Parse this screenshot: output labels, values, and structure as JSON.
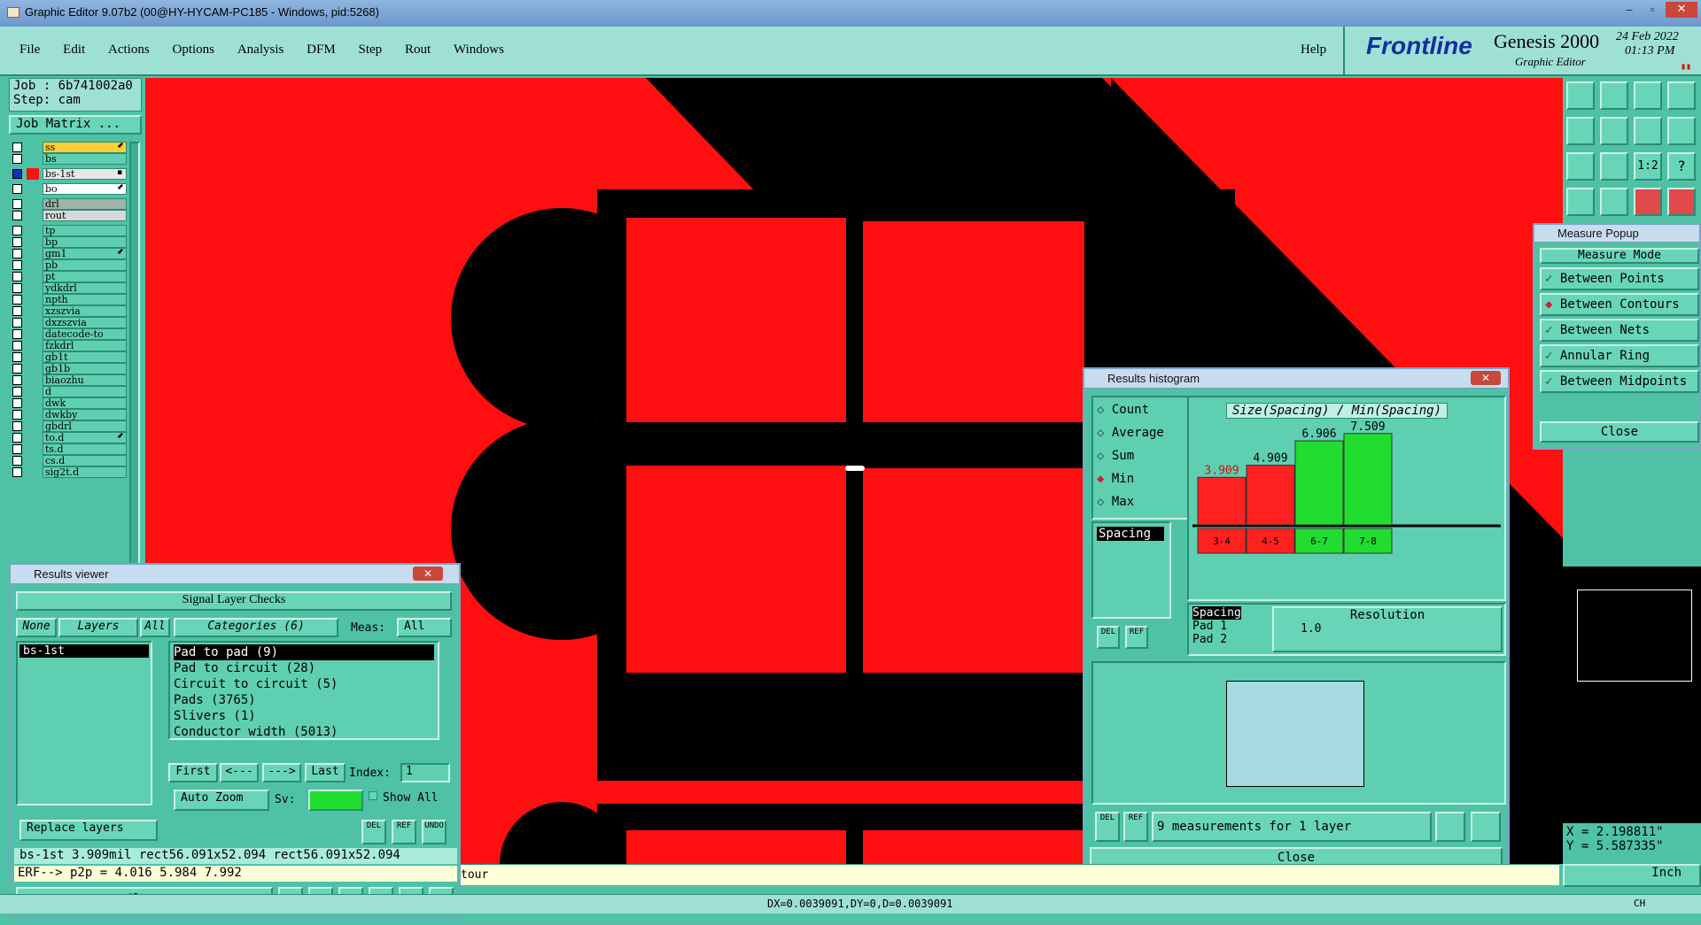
{
  "window_title": "Graphic Editor 9.07b2 (00@HY-HYCAM-PC185 - Windows, pid:5268)",
  "menu": [
    "File",
    "Edit",
    "Actions",
    "Options",
    "Analysis",
    "DFM",
    "Step",
    "Rout",
    "Windows"
  ],
  "help": "Help",
  "brand": {
    "logo": "Frontline",
    "product": "Genesis 2000",
    "sub": "Graphic Editor",
    "date": "24 Feb 2022",
    "time": "01:13 PM"
  },
  "job": {
    "job": "Job : 6b741002a0",
    "step": "Step: cam",
    "matrix": "Job Matrix ..."
  },
  "layers": [
    {
      "name": "ss",
      "color": "#ffcf3a",
      "mark": "⬋"
    },
    {
      "name": "bs",
      "color": "#5fcfb1",
      "mark": ""
    },
    {
      "name": "bs-1st",
      "color": "#e8e8e8",
      "mark": "▪",
      "active": true
    },
    {
      "name": "bo",
      "color": "#ffffff",
      "mark": "⬋"
    },
    {
      "name": "drl",
      "color": "#9fb3a8",
      "mark": ""
    },
    {
      "name": "rout",
      "color": "#d8d8d8",
      "mark": ""
    },
    {
      "name": "tp",
      "color": "#5fcfb1",
      "mark": ""
    },
    {
      "name": "bp",
      "color": "#5fcfb1",
      "mark": ""
    },
    {
      "name": "gm1",
      "color": "#5fcfb1",
      "mark": "⬋"
    },
    {
      "name": "pb",
      "color": "#5fcfb1",
      "mark": ""
    },
    {
      "name": "pt",
      "color": "#5fcfb1",
      "mark": ""
    },
    {
      "name": "ydkdrl",
      "color": "#5fcfb1",
      "mark": ""
    },
    {
      "name": "npth",
      "color": "#5fcfb1",
      "mark": ""
    },
    {
      "name": "xzszvia",
      "color": "#5fcfb1",
      "mark": ""
    },
    {
      "name": "dxzszvia",
      "color": "#5fcfb1",
      "mark": ""
    },
    {
      "name": "datecode-to",
      "color": "#5fcfb1",
      "mark": ""
    },
    {
      "name": "fzkdrl",
      "color": "#5fcfb1",
      "mark": ""
    },
    {
      "name": "gb1t",
      "color": "#5fcfb1",
      "mark": ""
    },
    {
      "name": "gb1b",
      "color": "#5fcfb1",
      "mark": ""
    },
    {
      "name": "biaozhu",
      "color": "#5fcfb1",
      "mark": ""
    },
    {
      "name": "d",
      "color": "#5fcfb1",
      "mark": ""
    },
    {
      "name": "dwk",
      "color": "#5fcfb1",
      "mark": ""
    },
    {
      "name": "dwkby",
      "color": "#5fcfb1",
      "mark": ""
    },
    {
      "name": "gbdrl",
      "color": "#5fcfb1",
      "mark": ""
    },
    {
      "name": "to.d",
      "color": "#5fcfb1",
      "mark": "⬋"
    },
    {
      "name": "ts.d",
      "color": "#5fcfb1",
      "mark": ""
    },
    {
      "name": "cs.d",
      "color": "#5fcfb1",
      "mark": ""
    },
    {
      "name": "sig2t.d",
      "color": "#5fcfb1",
      "mark": ""
    }
  ],
  "results_viewer": {
    "title": "Results viewer",
    "header": "Signal Layer Checks",
    "none": "None",
    "layers": "Layers",
    "all": "All",
    "categories": "Categories (6)",
    "meas_label": "Meas:",
    "meas_value": "All",
    "layer_list": [
      "bs-1st"
    ],
    "category_list": [
      "Pad to pad (9)",
      "Pad to circuit (28)",
      "Circuit to circuit (5)",
      "Pads (3765)",
      "Slivers (1)",
      "Conductor width (5013)"
    ],
    "first": "First",
    "prev": "<---",
    "next": "--->",
    "last": "Last",
    "index_label": "Index:",
    "index_value": "1",
    "auto_zoom": "Auto Zoom",
    "sv": "Sv:",
    "show_all": "Show All",
    "replace_layers": "Replace layers",
    "icons": [
      "DEL",
      "REF",
      "UNDO"
    ],
    "status": "bs-1st 3.909mil  rect56.091x52.094  rect56.091x52.094",
    "erf": "ERF--> p2p = 4.016 5.984 7.992",
    "close": "Close"
  },
  "histogram": {
    "title": "Results histogram",
    "options": [
      "Count",
      "Average",
      "Sum",
      "Min",
      "Max"
    ],
    "selected": "Min",
    "list_item": "Spacing",
    "chart_title": "Size(Spacing) / Min(Spacing)",
    "table_items": [
      "Spacing",
      "Pad 1",
      "Pad 2"
    ],
    "resolution_label": "Resolution",
    "resolution_value": "1.0",
    "info": "9 measurements for 1 layer",
    "close": "Close",
    "icons": [
      "DEL",
      "REF"
    ]
  },
  "chart_data": {
    "type": "bar",
    "title": "Size(Spacing) / Min(Spacing)",
    "categories": [
      "3-4",
      "4-5",
      "6-7",
      "7-8"
    ],
    "values": [
      3.909,
      4.909,
      6.906,
      7.509
    ],
    "colors": [
      "#ff2020",
      "#ff2020",
      "#20dd30",
      "#20dd30"
    ],
    "ylim": [
      0,
      8
    ]
  },
  "measure": {
    "title": "Measure Popup",
    "mode": "Measure Mode",
    "options": [
      "Between Points",
      "Between Contours",
      "Between Nets",
      "Annular Ring",
      "Between Midpoints"
    ],
    "selected": "Between Contours",
    "close": "Close"
  },
  "coords": {
    "x": "X = 2.198811\"",
    "y": "Y = 5.587335\"",
    "unit": "Inch"
  },
  "bottom": {
    "tour": "tour",
    "status": "DX=0.0039091,DY=0,D=0.0039091",
    "tray": "CH"
  }
}
